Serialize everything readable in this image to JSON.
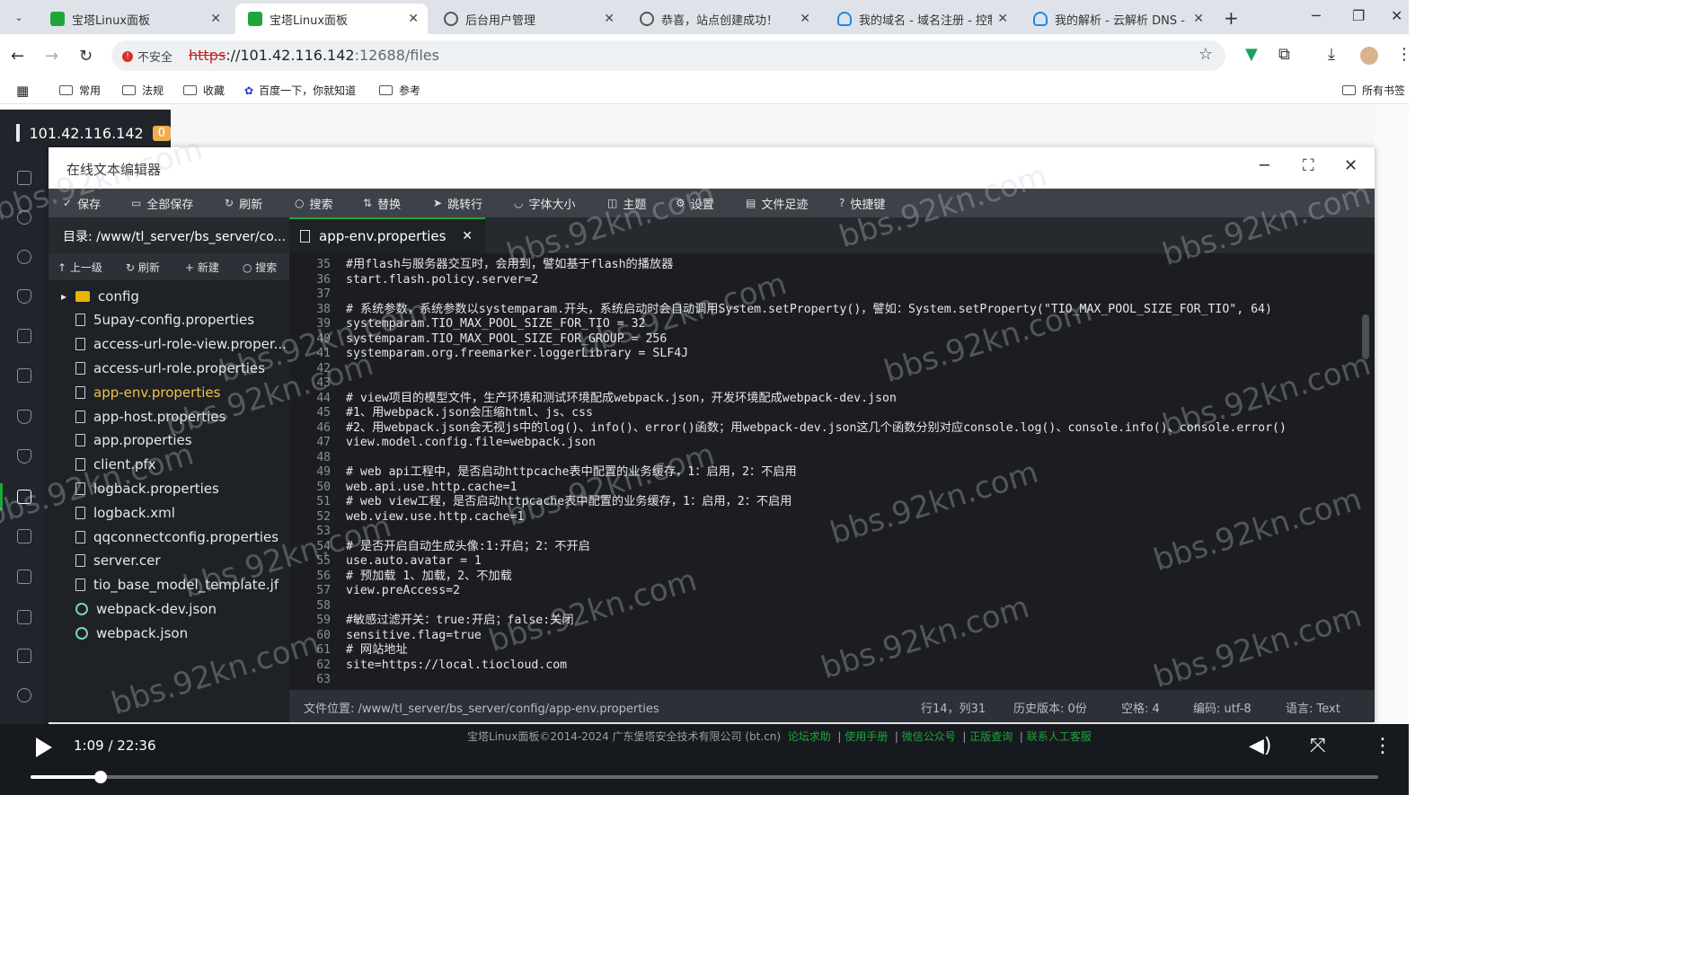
{
  "browser": {
    "tabs": [
      {
        "title": "宝塔Linux面板",
        "active": false
      },
      {
        "title": "宝塔Linux面板",
        "active": true
      },
      {
        "title": "后台用户管理",
        "active": false
      },
      {
        "title": "恭喜，站点创建成功！",
        "active": false
      },
      {
        "title": "我的域名 - 域名注册 - 控制",
        "active": false
      },
      {
        "title": "我的解析 - 云解析 DNS - 控",
        "active": false
      }
    ],
    "security_label": "不安全",
    "url_scheme": "https",
    "url_host": "://101.42.116.142",
    "url_path": ":12688/files",
    "bookmarks": [
      "常用",
      "法规",
      "收藏",
      "百度一下，你就知道",
      "参考"
    ],
    "all_bookmarks": "所有书签"
  },
  "panel": {
    "server_ip": "101.42.116.142",
    "badge": "0"
  },
  "editor": {
    "title": "在线文本编辑器",
    "toolbar": [
      "保存",
      "全部保存",
      "刷新",
      "搜索",
      "替换",
      "跳转行",
      "字体大小",
      "主题",
      "设置",
      "文件足迹",
      "快捷键"
    ],
    "dir_label": "目录: /www/tl_server/bs_server/co...",
    "file_toolbar": [
      "上一级",
      "刷新",
      "新建",
      "搜索"
    ],
    "files": [
      {
        "name": "config",
        "type": "folder"
      },
      {
        "name": "5upay-config.properties",
        "type": "file"
      },
      {
        "name": "access-url-role-view.proper...",
        "type": "file"
      },
      {
        "name": "access-url-role.properties",
        "type": "file"
      },
      {
        "name": "app-env.properties",
        "type": "file",
        "selected": true
      },
      {
        "name": "app-host.properties",
        "type": "file"
      },
      {
        "name": "app.properties",
        "type": "file"
      },
      {
        "name": "client.pfx",
        "type": "file"
      },
      {
        "name": "logback.properties",
        "type": "file"
      },
      {
        "name": "logback.xml",
        "type": "file"
      },
      {
        "name": "qqconnectconfig.properties",
        "type": "file"
      },
      {
        "name": "server.cer",
        "type": "file"
      },
      {
        "name": "tio_base_model_template.jf",
        "type": "file"
      },
      {
        "name": "webpack-dev.json",
        "type": "json"
      },
      {
        "name": "webpack.json",
        "type": "json"
      }
    ],
    "open_tab": "app-env.properties",
    "lines": [
      {
        "n": "35",
        "t": "#用flash与服务器交互时，会用到，譬如基于flash的播放器"
      },
      {
        "n": "36",
        "t": "start.flash.policy.server=2"
      },
      {
        "n": "37",
        "t": ""
      },
      {
        "n": "38",
        "t": "# 系统参数，系统参数以systemparam.开头，系统启动时会自动调用System.setProperty()，譬如：System.setProperty(\"TIO_MAX_POOL_SIZE_FOR_TIO\", 64)"
      },
      {
        "n": "39",
        "t": "systemparam.TIO_MAX_POOL_SIZE_FOR_TIO = 32"
      },
      {
        "n": "40",
        "t": "systemparam.TIO_MAX_POOL_SIZE_FOR_GROUP = 256"
      },
      {
        "n": "41",
        "t": "systemparam.org.freemarker.loggerLibrary = SLF4J"
      },
      {
        "n": "42",
        "t": ""
      },
      {
        "n": "43",
        "t": ""
      },
      {
        "n": "44",
        "t": "# view项目的模型文件，生产环境和测试环境配成webpack.json，开发环境配成webpack-dev.json"
      },
      {
        "n": "45",
        "t": "#1、用webpack.json会压缩html、js、css"
      },
      {
        "n": "46",
        "t": "#2、用webpack.json会无视js中的log()、info()、error()函数；用webpack-dev.json这几个函数分别对应console.log()、console.info()、console.error()"
      },
      {
        "n": "47",
        "t": "view.model.config.file=webpack.json"
      },
      {
        "n": "48",
        "t": ""
      },
      {
        "n": "49",
        "t": "# web api工程中，是否启动httpcache表中配置的业务缓存，1：启用，2：不启用"
      },
      {
        "n": "50",
        "t": "web.api.use.http.cache=1"
      },
      {
        "n": "51",
        "t": "# web view工程，是否启动httpcache表中配置的业务缓存，1：启用，2：不启用"
      },
      {
        "n": "52",
        "t": "web.view.use.http.cache=1"
      },
      {
        "n": "53",
        "t": ""
      },
      {
        "n": "54",
        "t": "# 是否开启自动生成头像:1:开启；2：不开启"
      },
      {
        "n": "55",
        "t": "use.auto.avatar = 1"
      },
      {
        "n": "56",
        "t": "# 预加载 1、加载，2、不加载"
      },
      {
        "n": "57",
        "t": "view.preAccess=2"
      },
      {
        "n": "58",
        "t": ""
      },
      {
        "n": "59",
        "t": "#敏感过滤开关：true:开启；false:关闭"
      },
      {
        "n": "60",
        "t": "sensitive.flag=true"
      },
      {
        "n": "61",
        "t": "# 网站地址"
      },
      {
        "n": "62",
        "t": "site=https://local.tiocloud.com"
      },
      {
        "n": "63",
        "t": ""
      }
    ],
    "status": {
      "path": "文件位置: /www/tl_server/bs_server/config/app-env.properties",
      "cursor": "行14，列31",
      "history": "历史版本: 0份",
      "indent": "空格: 4",
      "encoding": "编码: utf-8",
      "language": "语言: Text"
    }
  },
  "footer": {
    "copyright": "宝塔Linux面板©2014-2024 广东堡塔安全技术有限公司 (bt.cn)",
    "links": [
      "论坛求助",
      "使用手册",
      "微信公众号",
      "正版查询",
      "联系人工客服"
    ]
  },
  "video": {
    "time": "1:09 / 22:36",
    "progress_fraction": 0.052
  },
  "watermark": "bbs.92kn.com",
  "colors": {
    "accent": "#20a53a",
    "editor_bg": "#1b1d21",
    "toolbar_bg": "#3d4249",
    "selected_file": "#f0c14b"
  }
}
